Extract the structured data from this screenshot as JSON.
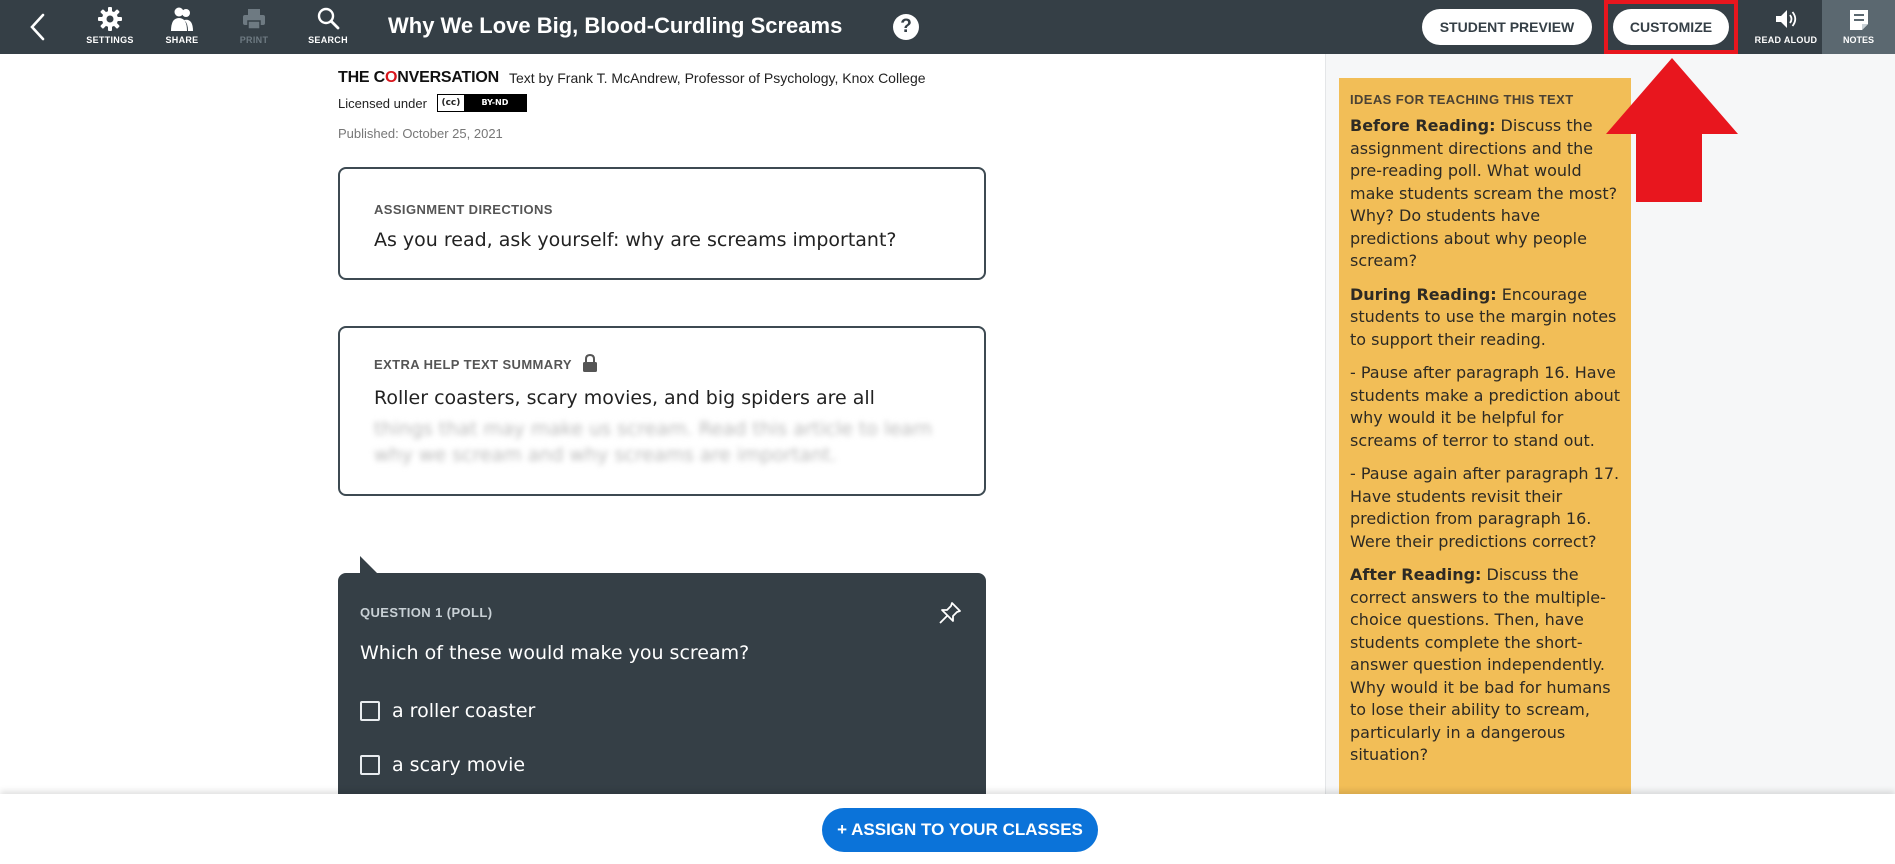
{
  "topbar": {
    "title": "Why We Love Big, Blood-Curdling Screams",
    "help_symbol": "?",
    "tools": [
      {
        "label": "SETTINGS",
        "icon": "gear-icon"
      },
      {
        "label": "SHARE",
        "icon": "people-icon"
      },
      {
        "label": "PRINT",
        "icon": "printer-icon",
        "disabled": true
      },
      {
        "label": "SEARCH",
        "icon": "magnifier-icon"
      }
    ],
    "student_preview_label": "STUDENT PREVIEW",
    "customize_label": "CUSTOMIZE",
    "read_aloud_label": "READ ALOUD",
    "notes_label": "NOTES"
  },
  "article": {
    "source_logo_prefix": "THE C",
    "source_logo_o": "O",
    "source_logo_suffix": "NVERSATION",
    "byline": "Text by Frank T. McAndrew, Professor of Psychology, Knox College",
    "license_prefix": "Licensed under",
    "license_badge_cc": "(cc)",
    "license_badge_by": "BY-ND",
    "published": "Published: October 25, 2021"
  },
  "directions": {
    "label": "ASSIGNMENT DIRECTIONS",
    "text": "As you read, ask yourself: why are screams important?"
  },
  "summary": {
    "label": "EXTRA HELP TEXT SUMMARY",
    "visible_text": "Roller coasters, scary movies, and big spiders are all",
    "blurred_text": "things that may make us scream. Read this article to learn why we scream and why screams are important."
  },
  "question": {
    "label": "QUESTION 1 (POLL)",
    "text": "Which of these would make you scream?",
    "options": [
      "a roller coaster",
      "a scary movie"
    ]
  },
  "teaching_tips": {
    "heading": "IDEAS FOR TEACHING THIS TEXT",
    "before_title": "Before Reading:",
    "before_text": " Discuss the assignment directions and the pre-reading poll. What would make students scream the most? Why? Do students have predictions about why people scream?",
    "during_title": "During Reading:",
    "during_text": " Encourage students to use the margin notes to support their reading.",
    "pause1": "- Pause after paragraph 16. Have students make a prediction about why would it be helpful for screams of terror to stand out.",
    "pause2": "- Pause again after paragraph 17. Have students revisit their prediction from paragraph 16. Were their predictions correct?",
    "after_title": "After Reading:",
    "after_text": " Discuss the correct answers to the multiple-choice questions. Then, have students complete the short-answer question independently. Why would it be bad for humans to lose their ability to scream, particularly in a dangerous situation?"
  },
  "bottom": {
    "assign_label": "+ ASSIGN TO YOUR CLASSES"
  },
  "colors": {
    "topbar": "#353f46",
    "highlight": "#e8161e",
    "tips_bg": "#f2be57",
    "assign_blue": "#0b73d9"
  }
}
